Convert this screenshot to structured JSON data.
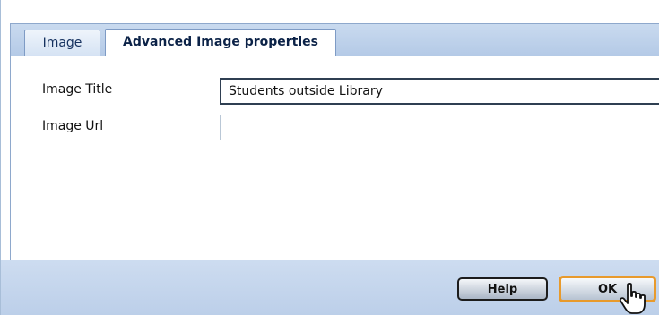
{
  "tabs": {
    "image": "Image",
    "advanced": "Advanced Image properties"
  },
  "form": {
    "title_label": "Image Title",
    "title_value": "Students outside Library",
    "url_label": "Image Url",
    "url_value": ""
  },
  "buttons": {
    "help": "Help",
    "ok": "OK"
  },
  "colors": {
    "tab_strip": "#b3c9e6",
    "footer": "#c4d6ec",
    "ok_focus_border": "#e89a2c"
  },
  "icons": {
    "cursor": "hand-pointer-icon"
  }
}
